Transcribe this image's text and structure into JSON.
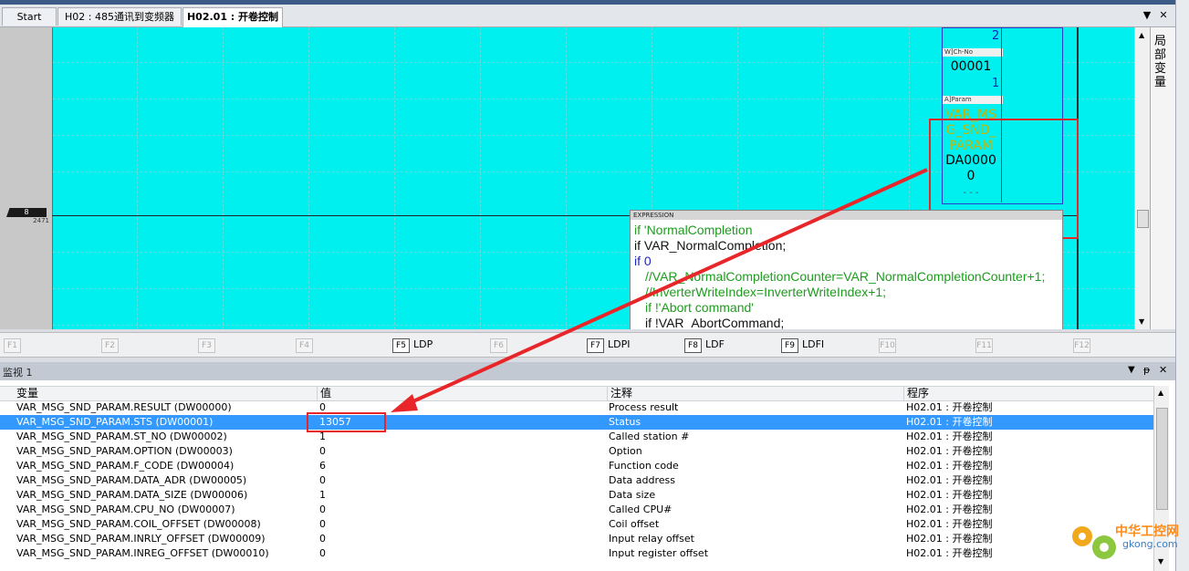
{
  "tabs": [
    {
      "label": "Start",
      "active": false
    },
    {
      "label": "H02 : 485通讯到变频器",
      "active": false
    },
    {
      "label": "H02.01 : 开卷控制",
      "active": true
    }
  ],
  "window_controls": {
    "dropdown": "▼",
    "close": "✕"
  },
  "ladder": {
    "rung_number": "8",
    "rung_address": "2471",
    "block": {
      "index_top": "2",
      "wch_header": "W]Ch-No",
      "wch_value": "00001",
      "wch_index": "1",
      "param_header": "A]Param",
      "param_lines": [
        "VAR_MS",
        "G_SND_",
        "PARAM"
      ],
      "param_address": "DA0000",
      "param_offset": "0",
      "param_dots": "- - -"
    },
    "expression": {
      "header": "EXPRESSION",
      "lines": [
        {
          "text": "if 'NormalCompletion",
          "color": "green",
          "indent": 0
        },
        {
          "text": "if VAR_NormalCompletion;",
          "color": "black",
          "indent": 0
        },
        {
          "text": "if 0",
          "color": "blue",
          "indent": 0
        },
        {
          "text": "//VAR_NormalCompletionCounter=VAR_NormalCompletionCounter+1;",
          "color": "green",
          "indent": 12
        },
        {
          "text": "//InverterWriteIndex=InverterWriteIndex+1;",
          "color": "green",
          "indent": 12
        },
        {
          "text": "if !'Abort command'",
          "color": "green",
          "indent": 12
        },
        {
          "text": "if !VAR_AbortCommand;",
          "color": "black",
          "indent": 12
        }
      ]
    }
  },
  "right_panel_text": "局部变量",
  "function_keys": [
    {
      "key": "F1",
      "label": "",
      "enabled": false
    },
    {
      "key": "F2",
      "label": "",
      "enabled": false
    },
    {
      "key": "F3",
      "label": "",
      "enabled": false
    },
    {
      "key": "F4",
      "label": "",
      "enabled": false
    },
    {
      "key": "F5",
      "label": "LDP",
      "enabled": true
    },
    {
      "key": "F6",
      "label": "",
      "enabled": false
    },
    {
      "key": "F7",
      "label": "LDPI",
      "enabled": true
    },
    {
      "key": "F8",
      "label": "LDF",
      "enabled": true
    },
    {
      "key": "F9",
      "label": "LDFI",
      "enabled": true
    },
    {
      "key": "F10",
      "label": "",
      "enabled": false
    },
    {
      "key": "F11",
      "label": "",
      "enabled": false
    },
    {
      "key": "F12",
      "label": "",
      "enabled": false
    }
  ],
  "watch": {
    "title": "监视 1",
    "pin": "ᵽ",
    "columns": [
      "变量",
      "值",
      "注释",
      "程序"
    ],
    "rows": [
      {
        "var": "VAR_MSG_SND_PARAM.RESULT (DW00000)",
        "value": "0",
        "comment": "Process result",
        "program": "H02.01 : 开卷控制",
        "selected": false
      },
      {
        "var": "VAR_MSG_SND_PARAM.STS (DW00001)",
        "value": "13057",
        "comment": "Status",
        "program": "H02.01 : 开卷控制",
        "selected": true
      },
      {
        "var": "VAR_MSG_SND_PARAM.ST_NO (DW00002)",
        "value": "1",
        "comment": "Called station #",
        "program": "H02.01 : 开卷控制",
        "selected": false
      },
      {
        "var": "VAR_MSG_SND_PARAM.OPTION (DW00003)",
        "value": "0",
        "comment": "Option",
        "program": "H02.01 : 开卷控制",
        "selected": false
      },
      {
        "var": "VAR_MSG_SND_PARAM.F_CODE (DW00004)",
        "value": "6",
        "comment": "Function code",
        "program": "H02.01 : 开卷控制",
        "selected": false
      },
      {
        "var": "VAR_MSG_SND_PARAM.DATA_ADR (DW00005)",
        "value": "0",
        "comment": "Data address",
        "program": "H02.01 : 开卷控制",
        "selected": false
      },
      {
        "var": "VAR_MSG_SND_PARAM.DATA_SIZE (DW00006)",
        "value": "1",
        "comment": "Data size",
        "program": "H02.01 : 开卷控制",
        "selected": false
      },
      {
        "var": "VAR_MSG_SND_PARAM.CPU_NO (DW00007)",
        "value": "0",
        "comment": "Called CPU#",
        "program": "H02.01 : 开卷控制",
        "selected": false
      },
      {
        "var": "VAR_MSG_SND_PARAM.COIL_OFFSET (DW00008)",
        "value": "0",
        "comment": "Coil offset",
        "program": "H02.01 : 开卷控制",
        "selected": false
      },
      {
        "var": "VAR_MSG_SND_PARAM.INRLY_OFFSET (DW00009)",
        "value": "0",
        "comment": "Input relay offset",
        "program": "H02.01 : 开卷控制",
        "selected": false
      },
      {
        "var": "VAR_MSG_SND_PARAM.INREG_OFFSET (DW00010)",
        "value": "0",
        "comment": "Input register offset",
        "program": "H02.01 : 开卷控制",
        "selected": false
      }
    ]
  },
  "watermark": {
    "line1": "中华工控网",
    "line2": "gkong.com"
  },
  "colors": {
    "ladder_bg": "#00f0f0",
    "highlight": "#e8262a",
    "selection": "#3399ff"
  }
}
